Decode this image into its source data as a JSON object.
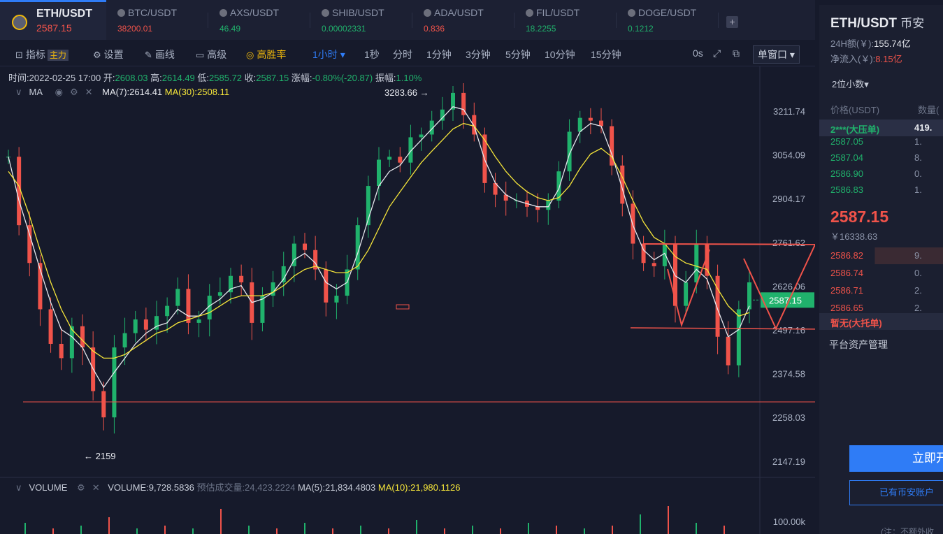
{
  "tabs": [
    {
      "pair": "ETH/USDT",
      "price": "2587.15",
      "price_color": "#f0534a",
      "active": true
    },
    {
      "pair": "BTC/USDT",
      "price": "38200.01",
      "price_color": "#f0534a"
    },
    {
      "pair": "AXS/USDT",
      "price": "46.49",
      "price_color": "#20b26c"
    },
    {
      "pair": "SHIB/USDT",
      "price": "0.00002331",
      "price_color": "#20b26c"
    },
    {
      "pair": "ADA/USDT",
      "price": "0.836",
      "price_color": "#f0534a"
    },
    {
      "pair": "FIL/USDT",
      "price": "18.2255",
      "price_color": "#20b26c"
    },
    {
      "pair": "DOGE/USDT",
      "price": "0.1212",
      "price_color": "#20b26c"
    }
  ],
  "add_tab": "+",
  "toolbar": {
    "indicators": "指标",
    "main_badge": "主力",
    "settings": "设置",
    "draw": "画线",
    "advanced": "高级",
    "win_rate": "高胜率",
    "interval_selected": "1小时",
    "intervals": [
      "1秒",
      "分时",
      "1分钟",
      "3分钟",
      "5分钟",
      "10分钟",
      "15分钟"
    ],
    "timer": "0s",
    "window_mode": "单窗口"
  },
  "info": {
    "time_label": "时间:",
    "time": "2022-02-25 17:00",
    "open_label": "开:",
    "open": "2608.03",
    "high_label": "高:",
    "high": "2614.49",
    "low_label": "低:",
    "low": "2585.72",
    "close_label": "收:",
    "close": "2587.15",
    "change_label": "涨幅:",
    "change": "-0.80%(-20.87)",
    "amp_label": "振幅:",
    "amp": "1.10%"
  },
  "ma": {
    "name": "MA",
    "ma7": "MA(7):2614.41",
    "ma30": "MA(30):2508.11"
  },
  "volume": {
    "name": "VOLUME",
    "value": "VOLUME:9,728.5836",
    "forecast": "预估成交量:24,423.2224",
    "ma5": "MA(5):21,834.4803",
    "ma10": "MA(10):21,980.1126"
  },
  "chart_data": {
    "type": "candlestick",
    "y_ticks": [
      "3211.74",
      "3054.09",
      "2904.17",
      "2761.62",
      "2626.06",
      "2497.16",
      "2374.58",
      "2258.03",
      "2147.19"
    ],
    "vol_tick": "100.00k",
    "current_price": "2587.15",
    "high_marker": "3283.66 →",
    "low_marker": "← 2159",
    "close_series": [
      3050,
      2820,
      2700,
      2560,
      2460,
      2420,
      2510,
      2450,
      2330,
      2260,
      2450,
      2490,
      2530,
      2500,
      2540,
      2570,
      2620,
      2520,
      2530,
      2600,
      2610,
      2660,
      2640,
      2520,
      2600,
      2640,
      2690,
      2760,
      2740,
      2680,
      2580,
      2600,
      2680,
      2820,
      2950,
      3040,
      3050,
      3030,
      3120,
      3130,
      3180,
      3220,
      3280,
      3200,
      3130,
      2960,
      2920,
      2900,
      2900,
      2880,
      2870,
      2900,
      3000,
      3140,
      3190,
      3180,
      3160,
      3020,
      2890,
      2760,
      2700,
      2690,
      2760,
      2570,
      2640,
      2760,
      2660,
      2480,
      2400,
      2560,
      2640
    ],
    "ma7_series": [
      3050,
      2900,
      2790,
      2680,
      2580,
      2500,
      2480,
      2450,
      2390,
      2340,
      2380,
      2420,
      2460,
      2490,
      2510,
      2520,
      2560,
      2540,
      2540,
      2570,
      2590,
      2620,
      2630,
      2580,
      2590,
      2610,
      2650,
      2710,
      2730,
      2700,
      2640,
      2620,
      2640,
      2730,
      2840,
      2950,
      3000,
      3020,
      3070,
      3110,
      3150,
      3190,
      3230,
      3220,
      3160,
      3040,
      2960,
      2920,
      2900,
      2890,
      2880,
      2880,
      2940,
      3060,
      3140,
      3170,
      3160,
      3060,
      2940,
      2820,
      2740,
      2710,
      2730,
      2660,
      2640,
      2680,
      2650,
      2560,
      2480,
      2500,
      2570
    ],
    "ma30_series": [
      3000,
      2950,
      2850,
      2740,
      2640,
      2560,
      2500,
      2470,
      2440,
      2420,
      2420,
      2430,
      2450,
      2470,
      2490,
      2500,
      2520,
      2530,
      2540,
      2550,
      2570,
      2590,
      2600,
      2600,
      2600,
      2610,
      2630,
      2660,
      2680,
      2690,
      2680,
      2670,
      2670,
      2690,
      2740,
      2810,
      2880,
      2930,
      2980,
      3030,
      3070,
      3110,
      3150,
      3170,
      3160,
      3110,
      3050,
      3000,
      2960,
      2930,
      2910,
      2900,
      2910,
      2950,
      3010,
      3060,
      3080,
      3050,
      2980,
      2900,
      2830,
      2780,
      2760,
      2720,
      2700,
      2690,
      2680,
      2620,
      2570,
      2540,
      2550
    ],
    "volume_spikes": [
      0.4,
      0.2,
      0.3,
      0.6,
      0.2,
      0.3,
      0.2,
      0.9,
      0.3,
      0.2,
      0.4,
      0.2,
      0.3,
      0.2,
      0.5,
      0.2,
      0.3,
      0.2,
      0.4,
      0.3,
      0.2,
      0.3,
      0.7,
      1.0,
      0.4,
      0.3
    ]
  },
  "right": {
    "pair": "ETH/USDT",
    "exchange": "币安",
    "vol24_label": "24H额(￥):",
    "vol24": "155.74亿",
    "inflow_label": "净流入(￥):",
    "inflow": "8.15亿",
    "digits": "2位小数▾",
    "col_price": "价格(USDT)",
    "col_qty": "数量(",
    "big_ask": {
      "label": "2***(大压单)",
      "qty": "419."
    },
    "asks": [
      {
        "price": "2587.05",
        "qty": "1."
      },
      {
        "price": "2587.04",
        "qty": "8."
      },
      {
        "price": "2586.90",
        "qty": "0."
      },
      {
        "price": "2586.83",
        "qty": "1."
      }
    ],
    "last_price": "2587.15",
    "last_cny": "￥16338.63",
    "bids": [
      {
        "price": "2586.82",
        "qty": "9."
      },
      {
        "price": "2586.74",
        "qty": "0."
      },
      {
        "price": "2586.71",
        "qty": "2."
      },
      {
        "price": "2586.65",
        "qty": "2."
      }
    ],
    "big_bid": "暂无(大托单)",
    "asset_mgmt": "平台资产管理",
    "open_btn": "立即开",
    "have_btn": "已有币安账户",
    "note": "(注：不额外收"
  }
}
